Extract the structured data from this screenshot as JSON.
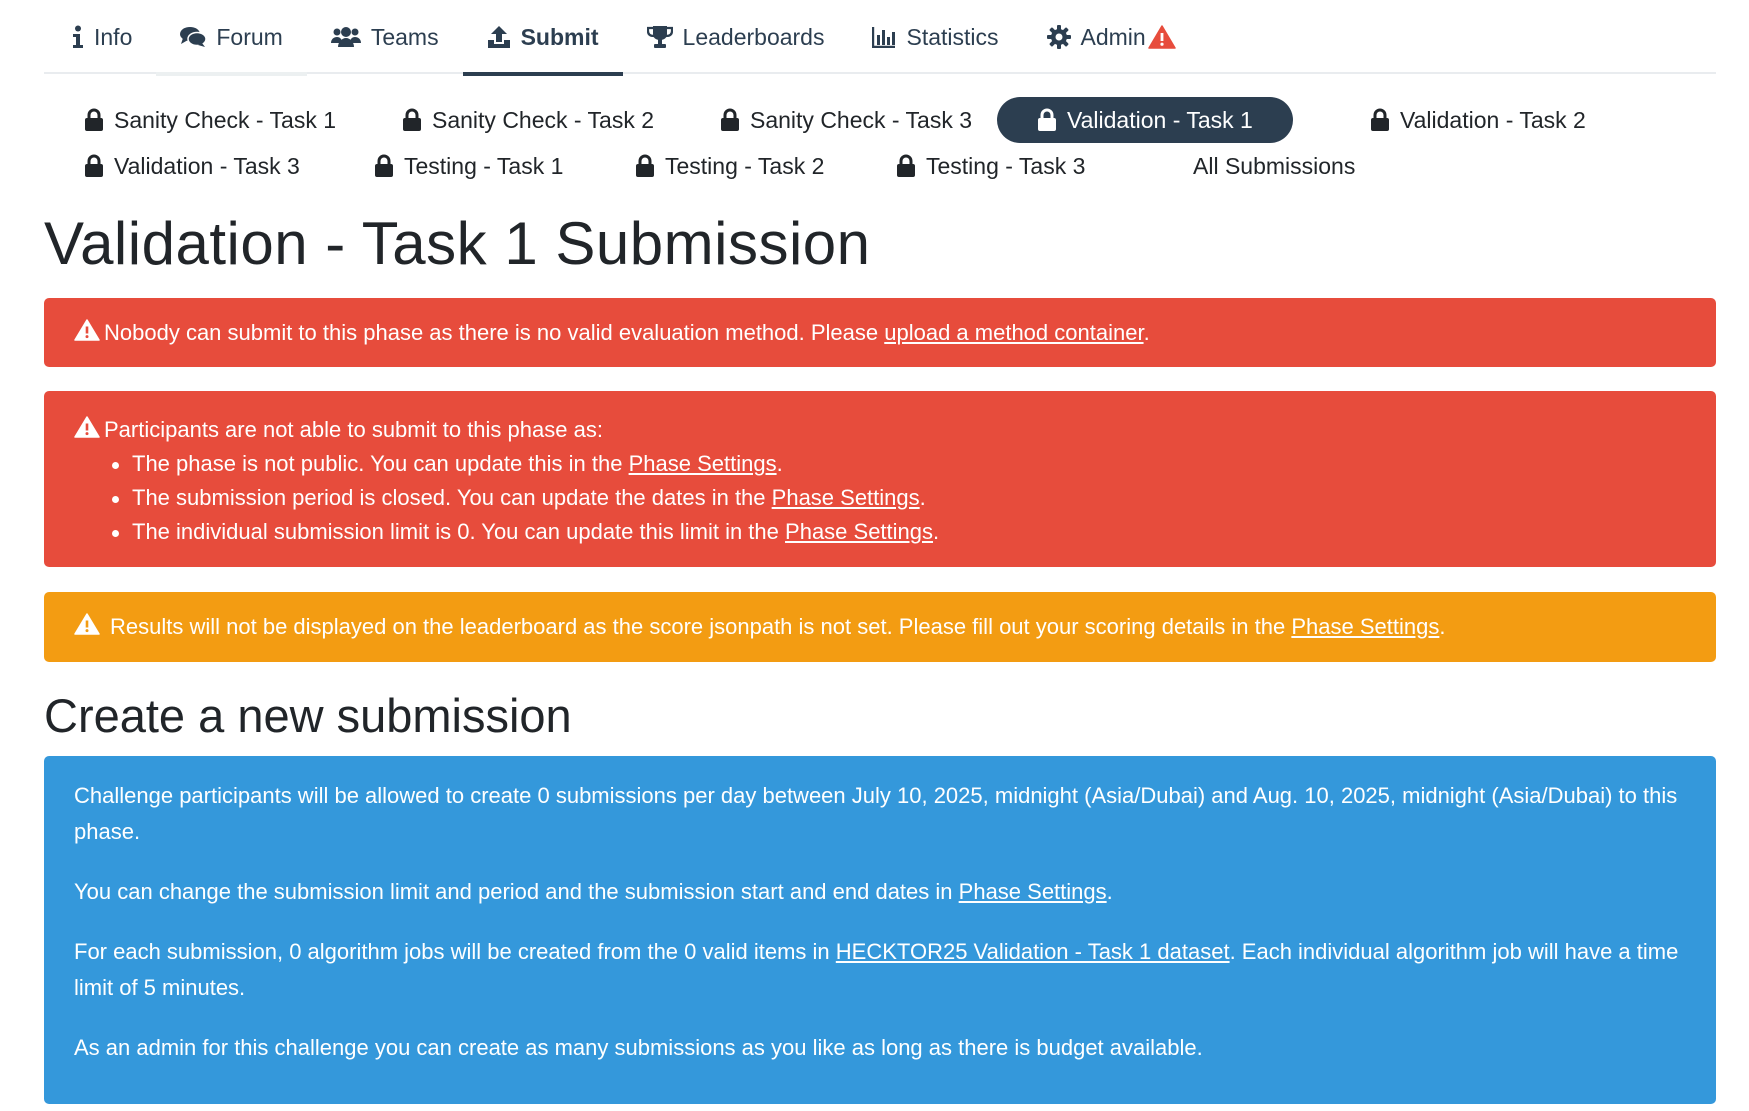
{
  "nav": {
    "items": [
      {
        "label": "Info",
        "icon": "info-icon"
      },
      {
        "label": "Forum",
        "icon": "comments-icon"
      },
      {
        "label": "Teams",
        "icon": "users-icon"
      },
      {
        "label": "Submit",
        "icon": "upload-icon",
        "active": true
      },
      {
        "label": "Leaderboards",
        "icon": "trophy-icon"
      },
      {
        "label": "Statistics",
        "icon": "chart-bar-icon"
      },
      {
        "label": "Admin",
        "icon": "gear-icon",
        "badge_icon": "warning-icon"
      }
    ]
  },
  "phases": [
    {
      "label": "Sanity Check - Task 1",
      "locked": true
    },
    {
      "label": "Sanity Check - Task 2",
      "locked": true
    },
    {
      "label": "Sanity Check - Task 3",
      "locked": true
    },
    {
      "label": "Validation - Task 1",
      "locked": true,
      "active": true
    },
    {
      "label": "Validation - Task 2",
      "locked": true
    },
    {
      "label": "Validation - Task 3",
      "locked": true
    },
    {
      "label": "Testing - Task 1",
      "locked": true
    },
    {
      "label": "Testing - Task 2",
      "locked": true
    },
    {
      "label": "Testing - Task 3",
      "locked": true
    },
    {
      "label": "All Submissions",
      "locked": false
    }
  ],
  "page_title": "Validation - Task 1 Submission",
  "alerts": {
    "no_method": {
      "text": "Nobody can submit to this phase as there is no valid evaluation method. Please",
      "link": "upload a method container",
      "after": "."
    },
    "not_able": {
      "title": "Participants are not able to submit to this phase as:",
      "items": [
        {
          "text": "The phase is not public. You can update this in the",
          "link": "Phase Settings",
          "after": "."
        },
        {
          "text": "The submission period is closed. You can update the dates in the",
          "link": "Phase Settings",
          "after": "."
        },
        {
          "text": "The individual submission limit is 0. You can update this limit in the",
          "link": "Phase Settings",
          "after": "."
        }
      ]
    },
    "results": {
      "text": "Results will not be displayed on the leaderboard as the score jsonpath is not set. Please fill out your scoring details in the",
      "link": "Phase Settings",
      "after": "."
    }
  },
  "section_title": "Create a new submission",
  "info": {
    "p1": "Challenge participants will be allowed to create 0 submissions per day between July 10, 2025, midnight (Asia/Dubai) and Aug. 10, 2025, midnight (Asia/Dubai) to this phase.",
    "p2_text": "You can change the submission limit and period and the submission start and end dates in",
    "p2_link": "Phase Settings",
    "p2_after": ".",
    "p3_text": "For each submission, 0 algorithm jobs will be created from the 0 valid items in",
    "p3_link": "HECKTOR25 Validation - Task 1 dataset",
    "p3_after": ". Each individual algorithm job will have a time limit of 5 minutes.",
    "p4": "As an admin for this challenge you can create as many submissions as you like as long as there is budget available."
  },
  "colors": {
    "navy": "#2c3e50",
    "danger": "#e74c3c",
    "warning": "#f39c12",
    "info": "#3498db"
  }
}
